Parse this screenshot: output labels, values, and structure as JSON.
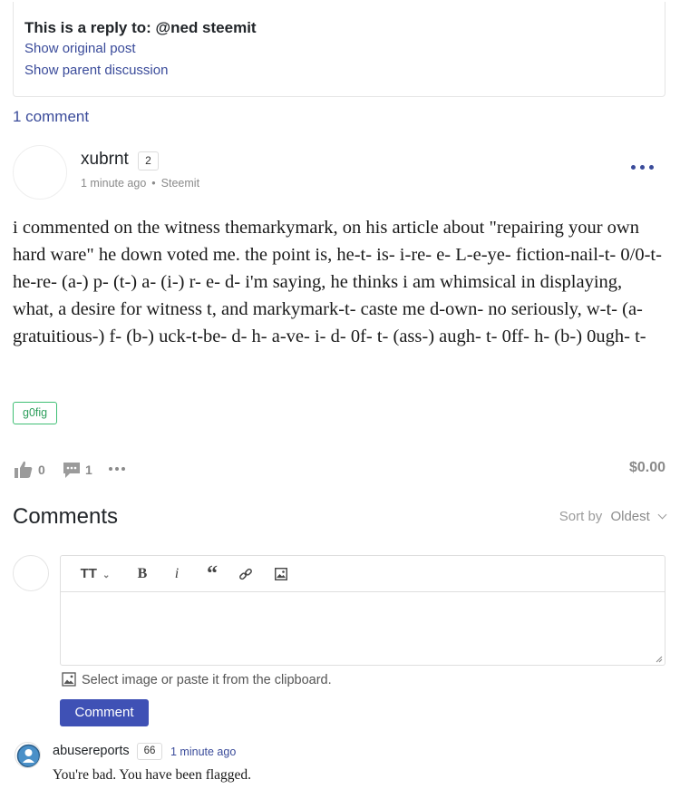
{
  "reply_context": {
    "title": "This is a reply to: @ned steemit",
    "show_original": "Show original post",
    "show_parent": "Show parent discussion"
  },
  "comment_count_label": "1 comment",
  "post": {
    "author": "xubrnt",
    "reputation": "2",
    "time": "1 minute ago",
    "app": "Steemit",
    "body": "i commented on the witness themarkymark, on his article about \"repairing your own hard ware\" he down voted me. the point is, he-t- is- i-re- e- L-e-ye- fiction-nail-t- 0/0-t-he-re- (a-) p- (t-) a- (i-) r- e- d- i'm saying, he thinks i am whimsical in displaying, what, a desire for witness t, and markymark-t- caste me d-own- no seriously, w-t- (a-gratuitious-) f- (b-) uck-t-be- d- h- a-ve- i- d- 0f- t- (ass-) augh- t- 0ff- h- (b-) 0ugh- t-",
    "tag": "g0fig",
    "votes": "0",
    "replies": "1",
    "payout": "$0.00"
  },
  "comments_section": {
    "heading": "Comments",
    "sort_label": "Sort by",
    "sort_value": "Oldest"
  },
  "editor": {
    "upload_hint": "Select image or paste it from the clipboard.",
    "submit_label": "Comment",
    "toolbar_icons": [
      "text-size-icon",
      "bold-icon",
      "italic-icon",
      "quote-icon",
      "link-icon",
      "image-icon"
    ],
    "toolbar_labels": {
      "heading": "TT",
      "bold": "B",
      "italic": "i",
      "quote": "“"
    }
  },
  "reply_comment": {
    "author": "abusereports",
    "reputation": "66",
    "time": "1 minute ago",
    "text": "You're bad. You have been flagged."
  },
  "colors": {
    "accent": "#3f51b5",
    "link": "#3a4b9a",
    "tag": "#3fbf74",
    "muted": "#8a8a8a"
  }
}
